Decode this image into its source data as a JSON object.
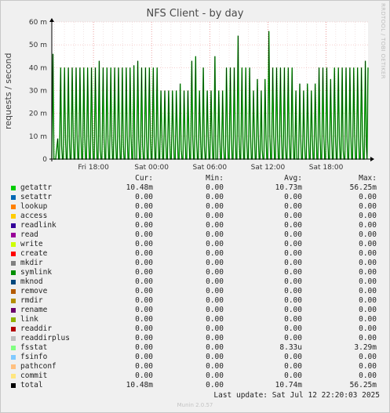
{
  "chart_title": "NFS Client - by day",
  "side_label": "RRDTOOL / TOBI OETIKER",
  "ylabel": "requests / second",
  "legend_headers": {
    "cur": "Cur:",
    "min": "Min:",
    "avg": "Avg:",
    "max": "Max:"
  },
  "legend": [
    {
      "name": "getattr",
      "color": "#00cc00",
      "cur": "10.48m",
      "min": "0.00",
      "avg": "10.73m",
      "max": "56.25m"
    },
    {
      "name": "setattr",
      "color": "#0066b3",
      "cur": "0.00",
      "min": "0.00",
      "avg": "0.00",
      "max": "0.00"
    },
    {
      "name": "lookup",
      "color": "#ff8000",
      "cur": "0.00",
      "min": "0.00",
      "avg": "0.00",
      "max": "0.00"
    },
    {
      "name": "access",
      "color": "#ffcc00",
      "cur": "0.00",
      "min": "0.00",
      "avg": "0.00",
      "max": "0.00"
    },
    {
      "name": "readlink",
      "color": "#330099",
      "cur": "0.00",
      "min": "0.00",
      "avg": "0.00",
      "max": "0.00"
    },
    {
      "name": "read",
      "color": "#990099",
      "cur": "0.00",
      "min": "0.00",
      "avg": "0.00",
      "max": "0.00"
    },
    {
      "name": "write",
      "color": "#ccff00",
      "cur": "0.00",
      "min": "0.00",
      "avg": "0.00",
      "max": "0.00"
    },
    {
      "name": "create",
      "color": "#ff0000",
      "cur": "0.00",
      "min": "0.00",
      "avg": "0.00",
      "max": "0.00"
    },
    {
      "name": "mkdir",
      "color": "#808080",
      "cur": "0.00",
      "min": "0.00",
      "avg": "0.00",
      "max": "0.00"
    },
    {
      "name": "symlink",
      "color": "#008f00",
      "cur": "0.00",
      "min": "0.00",
      "avg": "0.00",
      "max": "0.00"
    },
    {
      "name": "mknod",
      "color": "#00487d",
      "cur": "0.00",
      "min": "0.00",
      "avg": "0.00",
      "max": "0.00"
    },
    {
      "name": "remove",
      "color": "#b35a00",
      "cur": "0.00",
      "min": "0.00",
      "avg": "0.00",
      "max": "0.00"
    },
    {
      "name": "rmdir",
      "color": "#b38f00",
      "cur": "0.00",
      "min": "0.00",
      "avg": "0.00",
      "max": "0.00"
    },
    {
      "name": "rename",
      "color": "#6b006b",
      "cur": "0.00",
      "min": "0.00",
      "avg": "0.00",
      "max": "0.00"
    },
    {
      "name": "link",
      "color": "#8fb300",
      "cur": "0.00",
      "min": "0.00",
      "avg": "0.00",
      "max": "0.00"
    },
    {
      "name": "readdir",
      "color": "#b30000",
      "cur": "0.00",
      "min": "0.00",
      "avg": "0.00",
      "max": "0.00"
    },
    {
      "name": "readdirplus",
      "color": "#bebebe",
      "cur": "0.00",
      "min": "0.00",
      "avg": "0.00",
      "max": "0.00"
    },
    {
      "name": "fsstat",
      "color": "#80ff80",
      "cur": "0.00",
      "min": "0.00",
      "avg": "8.33u",
      "max": "3.29m"
    },
    {
      "name": "fsinfo",
      "color": "#80c9ff",
      "cur": "0.00",
      "min": "0.00",
      "avg": "0.00",
      "max": "0.00"
    },
    {
      "name": "pathconf",
      "color": "#ffc080",
      "cur": "0.00",
      "min": "0.00",
      "avg": "0.00",
      "max": "0.00"
    },
    {
      "name": "commit",
      "color": "#ffe680",
      "cur": "0.00",
      "min": "0.00",
      "avg": "0.00",
      "max": "0.00"
    },
    {
      "name": "total",
      "color": "#000000",
      "cur": "10.48m",
      "min": "0.00",
      "avg": "10.74m",
      "max": "56.25m"
    }
  ],
  "last_update": "Last update: Sat Jul 12 22:20:03 2025",
  "footer": "Munin 2.0.57",
  "chart_data": {
    "type": "line",
    "title": "NFS Client - by day",
    "ylabel": "requests / second",
    "xlabel": "",
    "y_ticks": [
      {
        "value": 0,
        "label": "0"
      },
      {
        "value": 10,
        "label": "10 m"
      },
      {
        "value": 20,
        "label": "20 m"
      },
      {
        "value": 30,
        "label": "30 m"
      },
      {
        "value": 40,
        "label": "40 m"
      },
      {
        "value": 50,
        "label": "50 m"
      },
      {
        "value": 60,
        "label": "60 m"
      }
    ],
    "ylim": [
      0,
      60
    ],
    "y_unit": "m (milli requests / second)",
    "x_hours_range": [
      -12.3,
      22.33
    ],
    "x_ticks": [
      {
        "hour": 18,
        "label": "Fri 18:00"
      },
      {
        "hour": 24,
        "label": "Sat 00:00"
      },
      {
        "hour": 30,
        "label": "Sat 06:00"
      },
      {
        "hour": 36,
        "label": "Sat 12:00"
      },
      {
        "hour": 42,
        "label": "Sat 18:00"
      }
    ],
    "x_start_hour": 13.7,
    "x_end_hour": 46.33,
    "spike_interval_hours": 0.5,
    "series": [
      {
        "name": "getattr",
        "color": "#00cc00",
        "spike_peaks": [
          46,
          5,
          40,
          40,
          40,
          40,
          40,
          40,
          40,
          40,
          40,
          40,
          43,
          40,
          40,
          40,
          40,
          40,
          40,
          40,
          40,
          41,
          43,
          40,
          40,
          40,
          40,
          40,
          30,
          30,
          30,
          30,
          30,
          33,
          30,
          30,
          43,
          45,
          30,
          40,
          30,
          30,
          45,
          30,
          30,
          40,
          40,
          40,
          54,
          40,
          40,
          40,
          30,
          35,
          30,
          35,
          56,
          40,
          40,
          40,
          40,
          40,
          40,
          30,
          33,
          30,
          33,
          30,
          33,
          40,
          40,
          40,
          35,
          40,
          40,
          40,
          40,
          40,
          40,
          40,
          40,
          43
        ],
        "dips": [
          0,
          9,
          6,
          10,
          9,
          10,
          10,
          10,
          9,
          10,
          10,
          10,
          4,
          9,
          10,
          10,
          9,
          10,
          6,
          10,
          10
        ]
      },
      {
        "name": "total",
        "color": "#000000"
      }
    ],
    "grid": true
  }
}
